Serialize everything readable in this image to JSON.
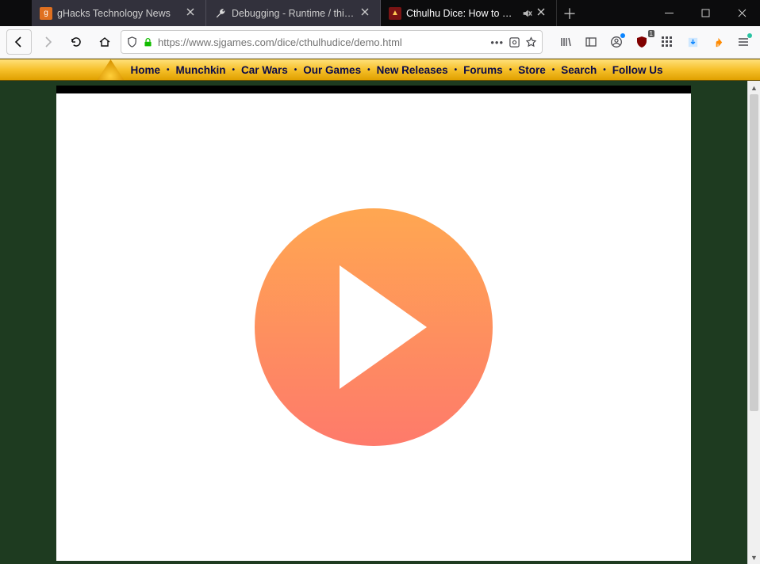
{
  "browser": {
    "tabs": [
      {
        "title": "gHacks Technology News",
        "icon_bg": "#e07020",
        "icon_glyph": "g"
      },
      {
        "title": "Debugging - Runtime / this-fir",
        "icon_bg": "#3a3a3a",
        "icon_glyph": "🔧"
      },
      {
        "title": "Cthulhu Dice: How to Play",
        "icon_bg": "#7a1414",
        "icon_glyph": "▲"
      }
    ],
    "url": "https://www.sjgames.com/dice/cthulhudice/demo.html"
  },
  "site_nav": {
    "items": [
      "Home",
      "Munchkin",
      "Car Wars",
      "Our Games",
      "New Releases",
      "Forums",
      "Store",
      "Search",
      "Follow Us"
    ]
  }
}
